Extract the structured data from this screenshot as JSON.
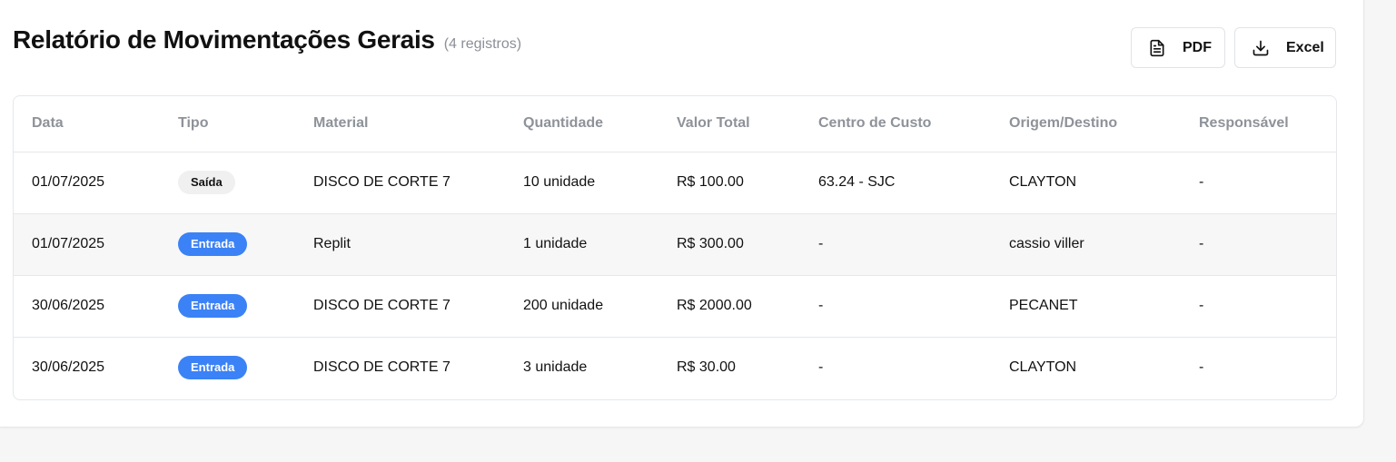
{
  "report": {
    "title": "Relatório de Movimentações Gerais",
    "count": "(4 registros)"
  },
  "actions": {
    "pdf_label": "PDF",
    "excel_label": "Excel",
    "pdf_icon": "file-text-icon",
    "excel_icon": "download-icon"
  },
  "colors": {
    "entrada_badge": "#3b82f6",
    "saida_badge": "#f0f0f0"
  },
  "table": {
    "columns": [
      "Data",
      "Tipo",
      "Material",
      "Quantidade",
      "Valor Total",
      "Centro de Custo",
      "Origem/Destino",
      "Responsável"
    ],
    "rows": [
      {
        "data": "01/07/2025",
        "tipo": "Saída",
        "material": "DISCO DE CORTE 7",
        "quantidade": "10 unidade",
        "valor": "R$ 100.00",
        "centro": "63.24 - SJC",
        "origem": "CLAYTON",
        "responsavel": "-"
      },
      {
        "data": "01/07/2025",
        "tipo": "Entrada",
        "material": "Replit",
        "quantidade": "1 unidade",
        "valor": "R$ 300.00",
        "centro": "-",
        "origem": "cassio viller",
        "responsavel": "-"
      },
      {
        "data": "30/06/2025",
        "tipo": "Entrada",
        "material": "DISCO DE CORTE 7",
        "quantidade": "200 unidade",
        "valor": "R$ 2000.00",
        "centro": "-",
        "origem": "PECANET",
        "responsavel": "-"
      },
      {
        "data": "30/06/2025",
        "tipo": "Entrada",
        "material": "DISCO DE CORTE 7",
        "quantidade": "3 unidade",
        "valor": "R$ 30.00",
        "centro": "-",
        "origem": "CLAYTON",
        "responsavel": "-"
      }
    ]
  }
}
